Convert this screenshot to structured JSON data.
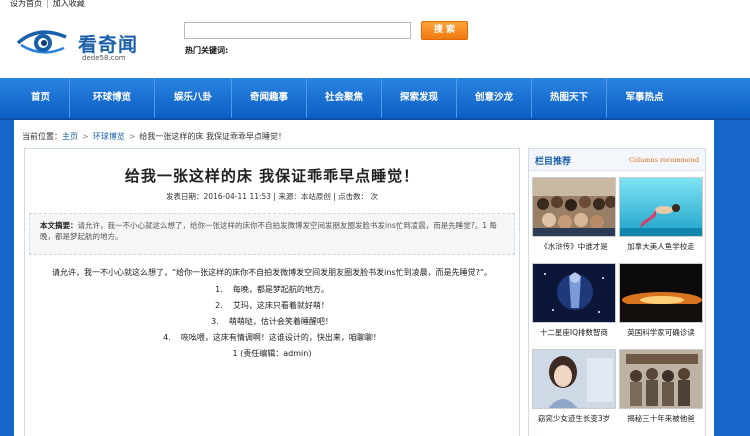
{
  "topbar": {
    "set_home": "设为首页",
    "add_fav": "加入收藏"
  },
  "header": {
    "logo_name": "看奇闻",
    "logo_domain": "dede58.com",
    "search_button": "搜 索",
    "hot_label": "热门关键词:"
  },
  "nav": {
    "items": [
      "首页",
      "环球博览",
      "娱乐八卦",
      "奇闻趣事",
      "社会聚焦",
      "探索发现",
      "创意沙龙",
      "热图天下",
      "军事热点"
    ]
  },
  "breadcrumb": {
    "label": "当前位置：",
    "home": "主页",
    "section": "环球博览",
    "current": "给我一张这样的床 我保证乖乖早点睡觉！"
  },
  "article": {
    "title": "给我一张这样的床  我保证乖乖早点睡觉！",
    "meta": "发表日期：2016-04-11 11:53 | 来源：本站原创 | 点击数：  次",
    "abstract_label": "本文摘要：",
    "abstract_text": "请允许，我一不小心就这么想了，给你一张这样的床你不自拍发微博发空间发朋友圈发脸书发ins忙到凌晨，而是先睡觉?。1 每晚，都是梦起航的地方。",
    "intro": "请允许，我一不小心就这么想了，“给你一张这样的床你不自拍发微博发空间发朋友圈发脸书发ins忙到凌晨，而是先睡觉?”。",
    "list": [
      {
        "num": "1.",
        "text": "每晚，都是梦起航的地方。"
      },
      {
        "num": "2.",
        "text": "艾玛，这床只看着就好萌！"
      },
      {
        "num": "3.",
        "text": "萌萌哒，估计会笑着睡醒吧！"
      },
      {
        "num": "4.",
        "text": "咴吆喂，这床有情调啊！这谁设计的，快出来，咱聊聊！"
      }
    ],
    "editor": "1 (责任编辑：admin)"
  },
  "sidebar": {
    "title": "栏目推荐",
    "title_en": "Columns recommend",
    "items": [
      {
        "caption": "《水浒传》中谁才是"
      },
      {
        "caption": "加拿大美人鱼学校走"
      },
      {
        "caption": "十二星座IQ排数智商"
      },
      {
        "caption": "英国科学家可确诊读"
      },
      {
        "caption": "窈窕少女迹生长变3岁"
      },
      {
        "caption": "揭秘三十年来被他爸"
      }
    ]
  },
  "colors": {
    "nav_blue": "#0c5fc4",
    "link_blue": "#1a5fa8",
    "search_orange": "#f07a12"
  }
}
